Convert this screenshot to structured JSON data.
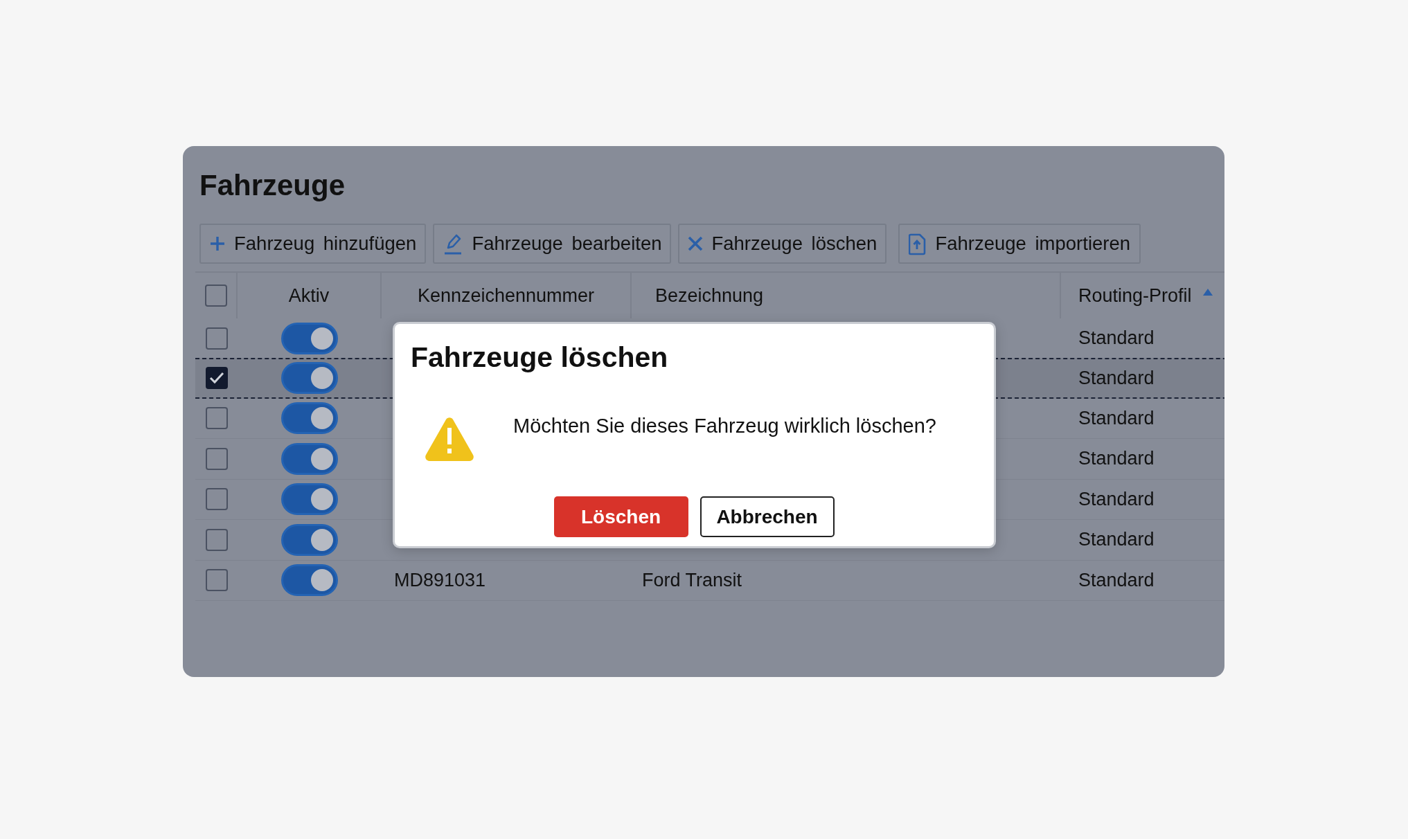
{
  "title": "Fahrzeuge",
  "toolbar": [
    {
      "label": "Fahrzeug hinzufügen"
    },
    {
      "label": "Fahrzeuge bearbeiten"
    },
    {
      "label": "Fahrzeuge löschen"
    },
    {
      "label": "Fahrzeuge importieren"
    }
  ],
  "table": {
    "select_all_checked": false,
    "columns": [
      {
        "label": "Aktiv",
        "sorted": false
      },
      {
        "label": "Kennzeichennummer",
        "sorted": false
      },
      {
        "label": "Bezeichnung",
        "sorted": false
      },
      {
        "label": "Routing-Profil",
        "sorted": true
      }
    ],
    "rows": [
      {
        "selected": false,
        "checked": false,
        "active": true,
        "routing_profile": "Standard"
      },
      {
        "selected": true,
        "checked": true,
        "active": true,
        "routing_profile": "Standard"
      },
      {
        "selected": false,
        "checked": false,
        "active": true,
        "routing_profile": "Standard"
      },
      {
        "selected": false,
        "checked": false,
        "active": true,
        "routing_profile": "Standard"
      },
      {
        "selected": false,
        "checked": false,
        "active": true,
        "routing_profile": "Standard"
      },
      {
        "selected": false,
        "checked": false,
        "active": true,
        "routing_profile": "Standard"
      },
      {
        "selected": false,
        "checked": false,
        "active": true,
        "plate": "MD891031",
        "name": "Ford Transit",
        "routing_profile": "Standard"
      }
    ]
  },
  "dialog": {
    "title": "Fahrzeuge löschen",
    "message": "Möchten Sie dieses Fahrzeug wirklich löschen?",
    "buttons": [
      {
        "label": "Löschen",
        "kind": "danger"
      },
      {
        "label": "Abbrechen",
        "kind": "secondary"
      }
    ]
  }
}
